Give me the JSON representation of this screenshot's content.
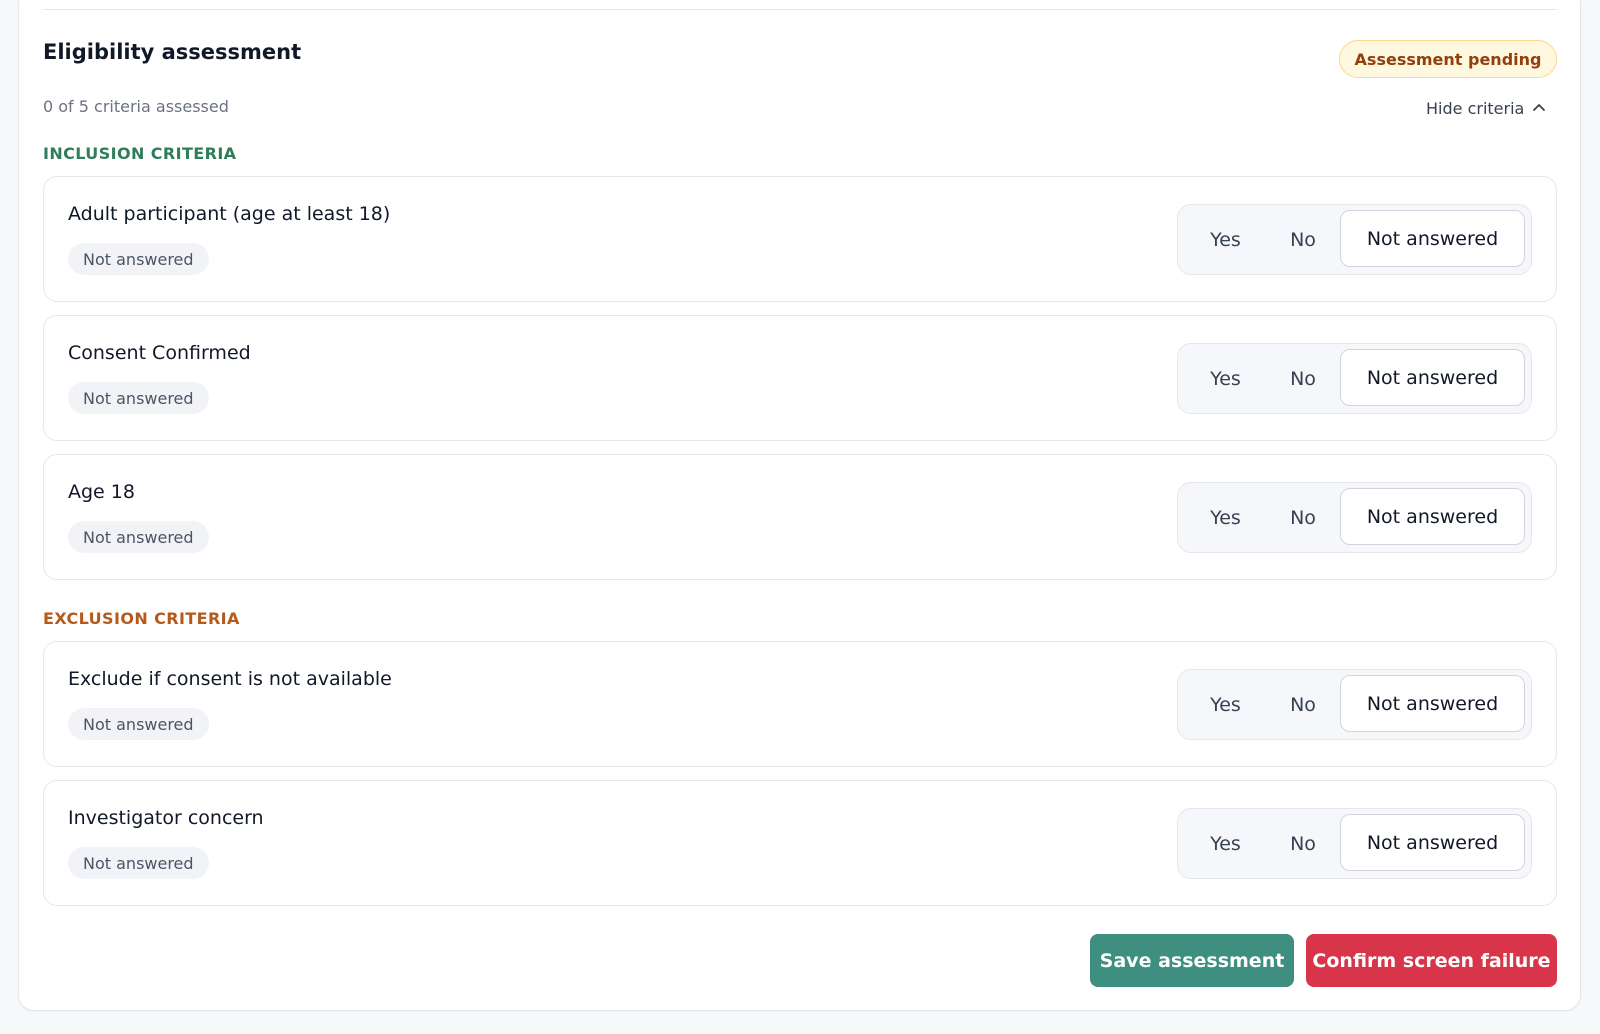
{
  "header": {
    "title": "Eligibility assessment",
    "status_badge": "Assessment pending",
    "progress": "0 of 5 criteria assessed",
    "toggle_label": "Hide criteria"
  },
  "inclusion": {
    "label": "INCLUSION CRITERIA",
    "items": [
      {
        "title": "Adult participant (age at least 18)",
        "status": "Not answered"
      },
      {
        "title": "Consent Confirmed",
        "status": "Not answered"
      },
      {
        "title": "Age 18",
        "status": "Not answered"
      }
    ]
  },
  "exclusion": {
    "label": "EXCLUSION CRITERIA",
    "items": [
      {
        "title": "Exclude if consent is not available",
        "status": "Not answered"
      },
      {
        "title": "Investigator concern",
        "status": "Not answered"
      }
    ]
  },
  "options": {
    "yes": "Yes",
    "no": "No",
    "not_answered": "Not answered",
    "selected": "not_answered"
  },
  "actions": {
    "save": "Save assessment",
    "confirm_failure": "Confirm screen failure"
  },
  "colors": {
    "inclusion": "#2f7d5b",
    "exclusion": "#b45a1b",
    "save": "#3f8f80",
    "danger": "#d8354a",
    "pending_badge_bg": "#fff8e1"
  },
  "icons": {
    "toggle": "chevron-up-icon"
  }
}
